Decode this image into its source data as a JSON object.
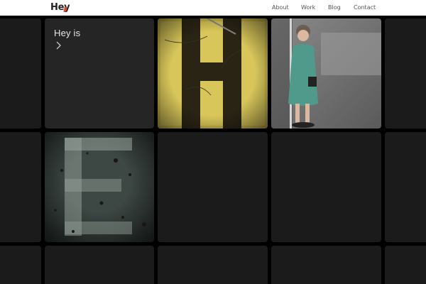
{
  "header": {
    "logo": "Hey",
    "nav": [
      {
        "label": "About"
      },
      {
        "label": "Work"
      },
      {
        "label": "Blog"
      },
      {
        "label": "Contact"
      }
    ]
  },
  "feature": {
    "title": "Hey is",
    "arrow_icon": "chevron-right-icon"
  },
  "tiles": {
    "photo_1": "letter-h-photo",
    "photo_2": "figurine-photo",
    "photo_3": "letter-e-photo"
  },
  "colors": {
    "accent": "#e04a2f",
    "header_bg": "#ffffff",
    "tile_bg": "#1b1b1b",
    "feature_bg": "#252525",
    "page_bg": "#000000"
  }
}
